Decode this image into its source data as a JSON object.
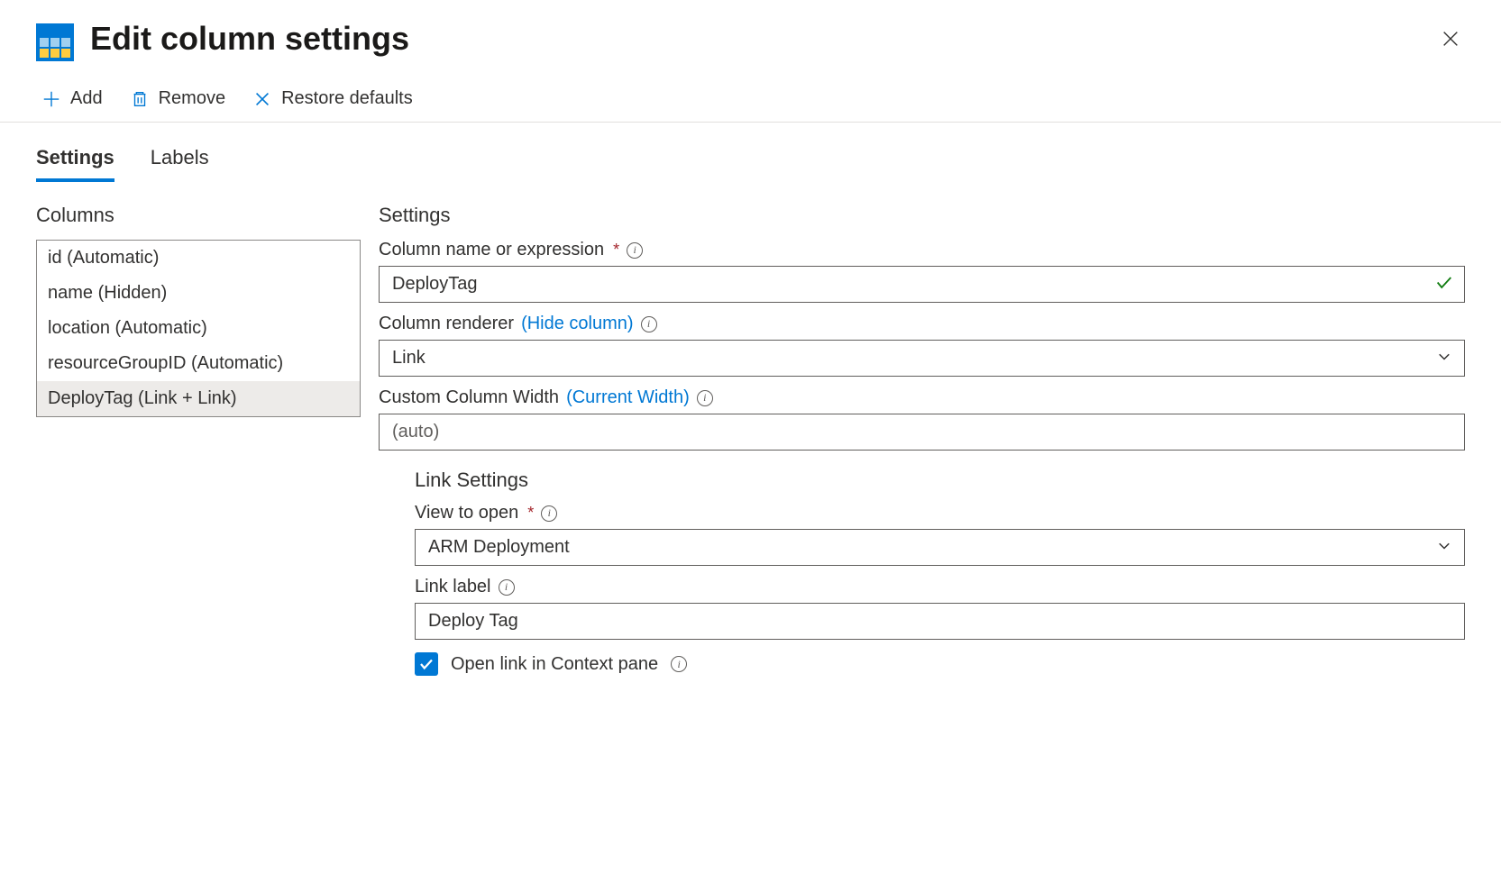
{
  "header": {
    "title": "Edit column settings"
  },
  "toolbar": {
    "add": "Add",
    "remove": "Remove",
    "restore": "Restore defaults"
  },
  "tabs": {
    "settings": "Settings",
    "labels": "Labels"
  },
  "columns": {
    "heading": "Columns",
    "items": [
      "id (Automatic)",
      "name (Hidden)",
      "location (Automatic)",
      "resourceGroupID (Automatic)",
      "DeployTag (Link + Link)"
    ]
  },
  "settings": {
    "heading": "Settings",
    "column_name_label": "Column name or expression",
    "column_name_value": "DeployTag",
    "renderer_label": "Column renderer",
    "renderer_hide": "(Hide column)",
    "renderer_value": "Link",
    "width_label": "Custom Column Width",
    "width_current": "(Current Width)",
    "width_placeholder": "(auto)",
    "link_settings_heading": "Link Settings",
    "view_label": "View to open",
    "view_value": "ARM Deployment",
    "link_label_label": "Link label",
    "link_label_value": "Deploy Tag",
    "open_context_label": "Open link in Context pane"
  }
}
